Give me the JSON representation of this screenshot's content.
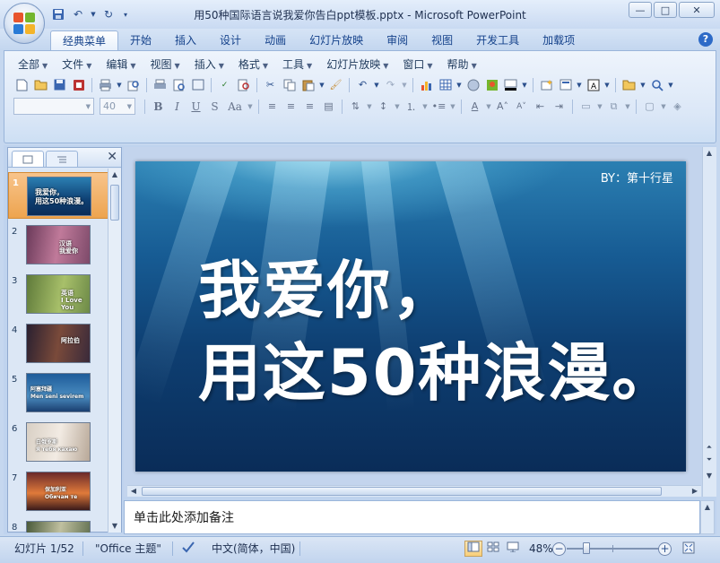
{
  "window": {
    "title": "用50种国际语言说我爱你告白ppt模板.pptx - Microsoft PowerPoint",
    "minimize": "—",
    "maximize": "□",
    "close": "✕"
  },
  "tabs": [
    {
      "label": "经典菜单",
      "active": true
    },
    {
      "label": "开始"
    },
    {
      "label": "插入"
    },
    {
      "label": "设计"
    },
    {
      "label": "动画"
    },
    {
      "label": "幻灯片放映"
    },
    {
      "label": "审阅"
    },
    {
      "label": "视图"
    },
    {
      "label": "开发工具"
    },
    {
      "label": "加载项"
    }
  ],
  "help": "?",
  "menu": [
    {
      "label": "全部"
    },
    {
      "label": "文件"
    },
    {
      "label": "编辑"
    },
    {
      "label": "视图"
    },
    {
      "label": "插入"
    },
    {
      "label": "格式"
    },
    {
      "label": "工具"
    },
    {
      "label": "幻灯片放映"
    },
    {
      "label": "窗口"
    },
    {
      "label": "帮助"
    }
  ],
  "format_bar": {
    "font_name": "",
    "font_size": "40",
    "bold": "B",
    "italic": "I",
    "underline": "U",
    "strike": "S",
    "case": "Aa"
  },
  "slides": [
    {
      "num": "1",
      "line1": "我爱你，",
      "line2": "用这50种浪漫。"
    },
    {
      "num": "2",
      "line1": "汉语",
      "line2": "我爱你"
    },
    {
      "num": "3",
      "line1": "英语",
      "line2": "I Love You"
    },
    {
      "num": "4",
      "line1": "阿拉伯",
      "line2": ""
    },
    {
      "num": "5",
      "line1": "阿塞拜疆",
      "line2": "Men seni sevirem"
    },
    {
      "num": "6",
      "line1": "白俄罗斯",
      "line2": "Я тебя кахаю"
    },
    {
      "num": "7",
      "line1": "保加利亚",
      "line2": "Обичам те"
    },
    {
      "num": "8",
      "line1": "",
      "line2": ""
    }
  ],
  "current_slide": {
    "by": "BY：第十行星",
    "line1": "我爱你，",
    "line2": "用这50种浪漫。"
  },
  "notes": {
    "placeholder": "单击此处添加备注"
  },
  "status": {
    "slide": "幻灯片 1/52",
    "theme": "\"Office 主题\"",
    "language": "中文(简体，中国)",
    "zoom": "48%"
  },
  "colors": {
    "accent": "#15428b",
    "selected_thumb": "#eda44f",
    "slide_deep": "#0a2c58"
  }
}
